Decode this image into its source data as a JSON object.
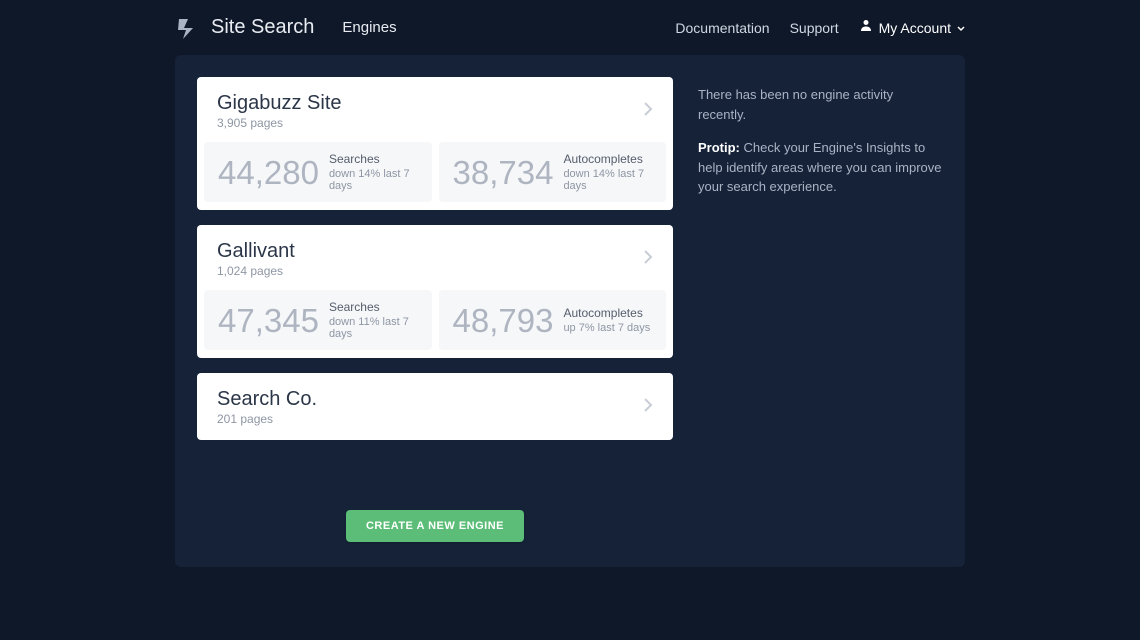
{
  "header": {
    "logo_text": "Site Search",
    "nav_engines": "Engines",
    "documentation": "Documentation",
    "support": "Support",
    "my_account": "My Account"
  },
  "engines": [
    {
      "title": "Gigabuzz Site",
      "subtitle": "3,905 pages",
      "searches_count": "44,280",
      "searches_label": "Searches",
      "searches_trend": "down 14% last 7 days",
      "autocompletes_count": "38,734",
      "autocompletes_label": "Autocompletes",
      "autocompletes_trend": "down 14% last 7 days"
    },
    {
      "title": "Gallivant",
      "subtitle": "1,024 pages",
      "searches_count": "47,345",
      "searches_label": "Searches",
      "searches_trend": "down 11% last 7 days",
      "autocompletes_count": "48,793",
      "autocompletes_label": "Autocompletes",
      "autocompletes_trend": "up 7% last 7 days"
    },
    {
      "title": "Search Co.",
      "subtitle": "201 pages"
    }
  ],
  "create_button": "CREATE A NEW ENGINE",
  "sidebar": {
    "activity_text": "There has been no engine activity recently.",
    "protip_label": "Protip:",
    "protip_text": " Check your Engine's Insights to help identify areas where you can improve your search experience."
  }
}
